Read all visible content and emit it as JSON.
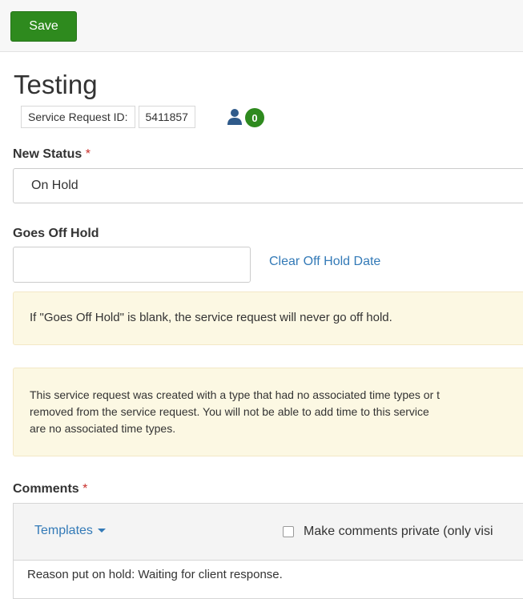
{
  "toolbar": {
    "save_label": "Save"
  },
  "page": {
    "title": "Testing",
    "service_request_label": "Service Request ID:",
    "service_request_id": "5411857",
    "assignee_count": "0"
  },
  "new_status": {
    "label": "New Status",
    "required_marker": "*",
    "value": "On Hold"
  },
  "off_hold": {
    "label": "Goes Off Hold",
    "value": "",
    "clear_link": "Clear Off Hold Date"
  },
  "alerts": {
    "off_hold_note": "If \"Goes Off Hold\" is blank, the service request will never go off hold.",
    "time_types_line1": "This service request was created with a type that had no associated time types or t",
    "time_types_line2": "removed from the service request. You will not be able to add time to this service",
    "time_types_line3": "are no associated time types."
  },
  "comments": {
    "label": "Comments",
    "required_marker": "*",
    "templates_label": "Templates",
    "private_label": "Make comments private (only visi",
    "private_checked": false,
    "text": "Reason put on hold:  Waiting for client response."
  },
  "colors": {
    "primary_green": "#2e8a1e",
    "link_blue": "#337ab7",
    "alert_bg": "#fcf8e3",
    "required_red": "#c9302c"
  },
  "icons": {
    "assignee": "user-icon",
    "dropdown": "caret-down-icon",
    "checkbox": "checkbox-icon"
  }
}
